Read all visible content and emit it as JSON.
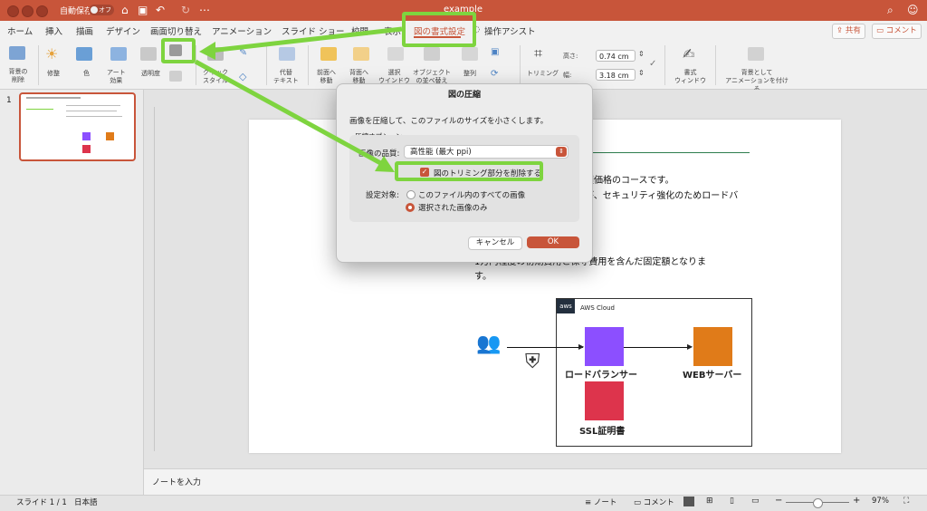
{
  "titlebar": {
    "autosave": "自動保存",
    "toggle": "オフ",
    "doc_title": "example"
  },
  "tabs": [
    "ホーム",
    "挿入",
    "描画",
    "デザイン",
    "画面切り替え",
    "アニメーション",
    "スライド ショー",
    "校閲",
    "表示",
    "図の書式設定",
    "操作アシスト"
  ],
  "topbar": {
    "share": "共有",
    "comment": "コメント"
  },
  "ribbon": {
    "remove_bg": "背景の\n削除",
    "corrections": "修整",
    "color": "色",
    "art_effects": "アート\n効果",
    "transparency": "透明度",
    "quick_styles": "クイック\nスタイル",
    "alt_text": "代替\nテキスト",
    "bring_forward": "前面へ\n移動",
    "send_backward": "背面へ\n移動",
    "selection_pane": "選択\nウインドウ",
    "arrange_objects": "オブジェクト\nの並べ替え",
    "align": "整列",
    "crop": "トリミング",
    "height_label": "高さ:",
    "height_value": "0.74 cm",
    "width_label": "幅:",
    "width_value": "3.18 cm",
    "format_pane": "書式\nウィンドウ",
    "animate_bg": "背景として\nアニメーションを付ける"
  },
  "thumbnail": {
    "number": "1"
  },
  "slide": {
    "line1": "手頃価格のコースです。",
    "line2": "すが、セキュリティ強化のためロードバ",
    "line3": "1万円程度の初期費用と保守費用を含んだ固定額となりま",
    "line4": "す。",
    "aws_badge": "aws",
    "aws_cloud": "AWS Cloud",
    "lb": "ロードバランサー",
    "web": "WEBサーバー",
    "ssl": "SSL証明書"
  },
  "dialog": {
    "title": "図の圧縮",
    "description": "画像を圧縮して、このファイルのサイズを小さくします。",
    "group_label": "圧縮オプション",
    "quality_label": "画像の品質:",
    "quality_value": "高性能 (最大 ppi)",
    "delete_cropped": "図のトリミング部分を削除する",
    "apply_label": "設定対象:",
    "radio_all": "このファイル内のすべての画像",
    "radio_selected": "選択された画像のみ",
    "cancel": "キャンセル",
    "ok": "OK"
  },
  "notes": {
    "placeholder": "ノートを入力"
  },
  "status": {
    "slide": "スライド 1 / 1",
    "language": "日本語",
    "notes": "ノート",
    "comments": "コメント",
    "zoom": "97%"
  },
  "colors": {
    "accent": "#c8553a",
    "annotation": "#7ed43f",
    "aws_orange": "#e07b19",
    "aws_purple": "#8c4fff",
    "aws_red": "#dd344c"
  }
}
